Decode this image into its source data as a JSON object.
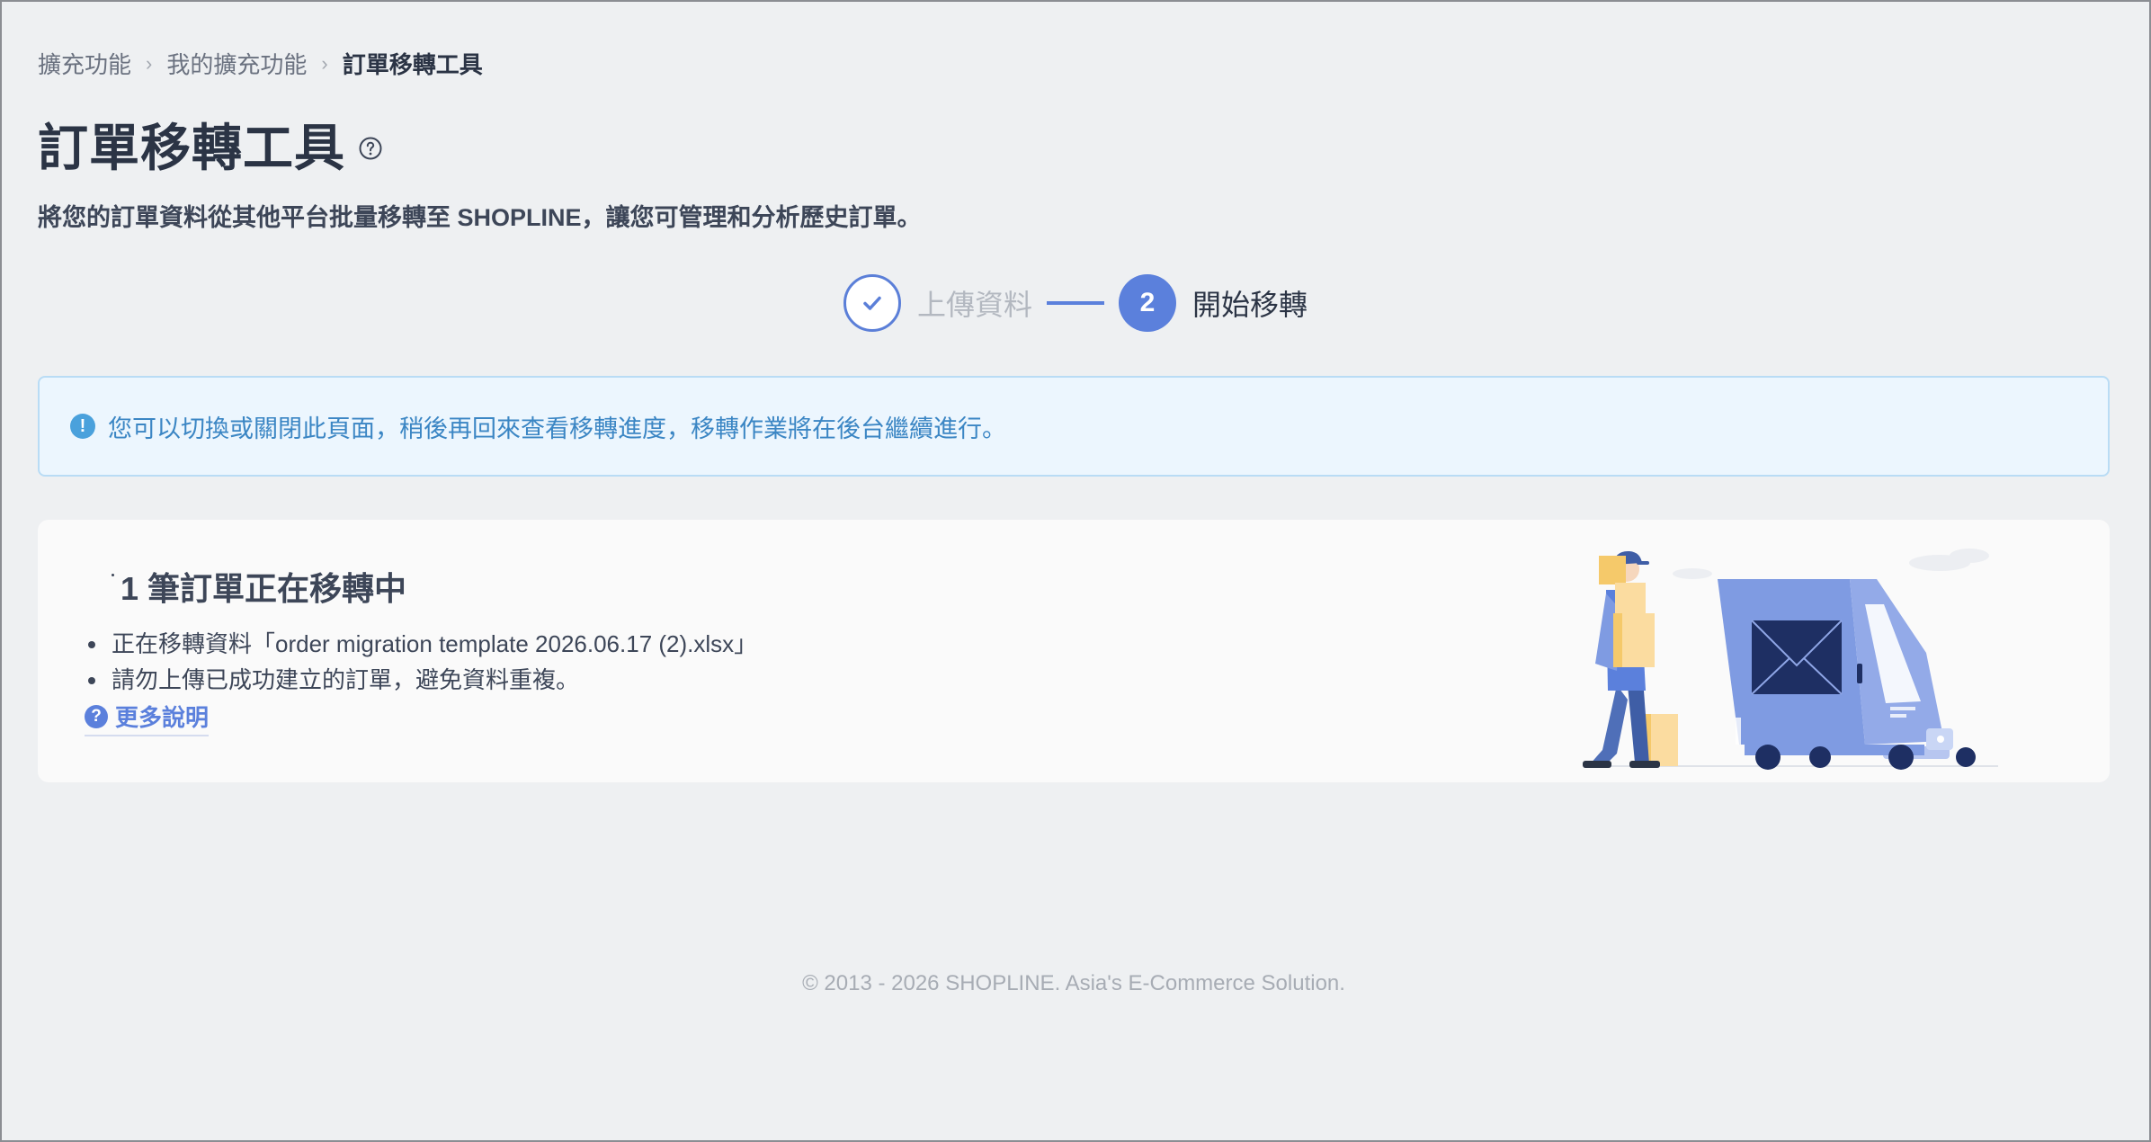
{
  "breadcrumb": {
    "items": [
      "擴充功能",
      "我的擴充功能"
    ],
    "current": "訂單移轉工具",
    "separator": "›"
  },
  "header": {
    "title": "訂單移轉工具",
    "subtitle": "將您的訂單資料從其他平台批量移轉至 SHOPLINE，讓您可管理和分析歷史訂單。"
  },
  "stepper": {
    "steps": [
      {
        "label": "上傳資料",
        "state": "done"
      },
      {
        "label": "開始移轉",
        "state": "active",
        "number": "2"
      }
    ]
  },
  "banner": {
    "icon": "exclamation-circle-icon",
    "text": "您可以切換或關閉此頁面，稍後再回來查看移轉進度，移轉作業將在後台繼續進行。"
  },
  "card": {
    "title": "1 筆訂單正在移轉中",
    "bullets": [
      "正在移轉資料「order migration template 2026.06.17 (2).xlsx」",
      "請勿上傳已成功建立的訂單，避免資料重複。"
    ],
    "more_link": "更多說明"
  },
  "footer": {
    "text": "© 2013 - 2026 SHOPLINE. Asia's E-Commerce Solution."
  },
  "colors": {
    "accent": "#5b80dc",
    "banner_bg": "#ecf6fe",
    "banner_text": "#3b86c4",
    "page_bg": "#eef0f2"
  }
}
